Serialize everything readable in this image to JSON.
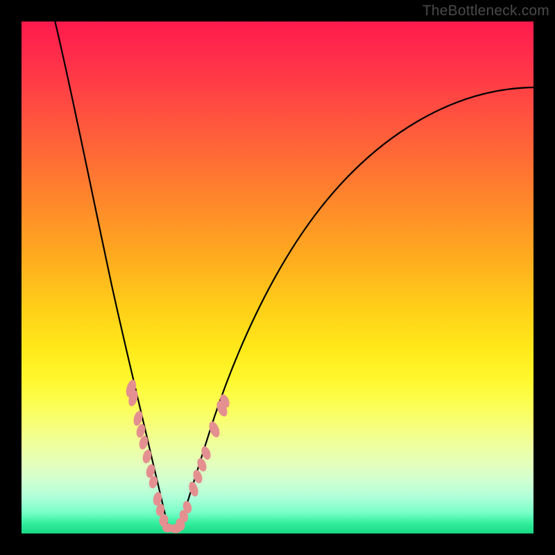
{
  "watermark": "TheBottleneck.com",
  "chart_data": {
    "type": "line",
    "title": "",
    "xlabel": "",
    "ylabel": "",
    "xlim": [
      0,
      100
    ],
    "ylim": [
      0,
      100
    ],
    "grid": false,
    "legend": false,
    "background": "vertical-heatmap-gradient",
    "gradient_stops": [
      {
        "pos": 0.0,
        "color": "#ff1a4d"
      },
      {
        "pos": 0.5,
        "color": "#ffd018"
      },
      {
        "pos": 0.75,
        "color": "#fbff55"
      },
      {
        "pos": 1.0,
        "color": "#18d884"
      }
    ],
    "series": [
      {
        "name": "left-curve",
        "color": "#000000",
        "width": 2,
        "x": [
          6,
          8,
          10,
          12,
          14,
          16,
          18,
          20,
          22,
          24,
          25.5,
          27
        ],
        "y": [
          100,
          88,
          76,
          65,
          54,
          44,
          34,
          25,
          17,
          9,
          4,
          0
        ]
      },
      {
        "name": "right-curve",
        "color": "#000000",
        "width": 2,
        "x": [
          30,
          33,
          36,
          40,
          45,
          52,
          60,
          70,
          82,
          95,
          100
        ],
        "y": [
          0,
          8,
          17,
          27,
          38,
          50,
          60,
          69,
          77,
          83,
          85
        ]
      }
    ],
    "markers": {
      "type": "scatter",
      "shape": "pill",
      "color": "#e68a8a",
      "note": "approximate marker positions along curves",
      "points": [
        {
          "x": 19.5,
          "y": 27
        },
        {
          "x": 20.0,
          "y": 25
        },
        {
          "x": 21.0,
          "y": 21
        },
        {
          "x": 21.8,
          "y": 18
        },
        {
          "x": 22.3,
          "y": 16
        },
        {
          "x": 23.0,
          "y": 13
        },
        {
          "x": 23.8,
          "y": 10
        },
        {
          "x": 24.3,
          "y": 8
        },
        {
          "x": 25.2,
          "y": 5
        },
        {
          "x": 25.8,
          "y": 3
        },
        {
          "x": 26.5,
          "y": 1.5
        },
        {
          "x": 27.5,
          "y": 0.8
        },
        {
          "x": 29.0,
          "y": 0.8
        },
        {
          "x": 30.0,
          "y": 1.2
        },
        {
          "x": 30.8,
          "y": 2.5
        },
        {
          "x": 31.5,
          "y": 4
        },
        {
          "x": 33.0,
          "y": 8
        },
        {
          "x": 34.0,
          "y": 11
        },
        {
          "x": 35.0,
          "y": 14
        },
        {
          "x": 35.8,
          "y": 16.5
        },
        {
          "x": 37.5,
          "y": 21
        },
        {
          "x": 39.0,
          "y": 25
        },
        {
          "x": 39.5,
          "y": 26.5
        }
      ]
    }
  }
}
